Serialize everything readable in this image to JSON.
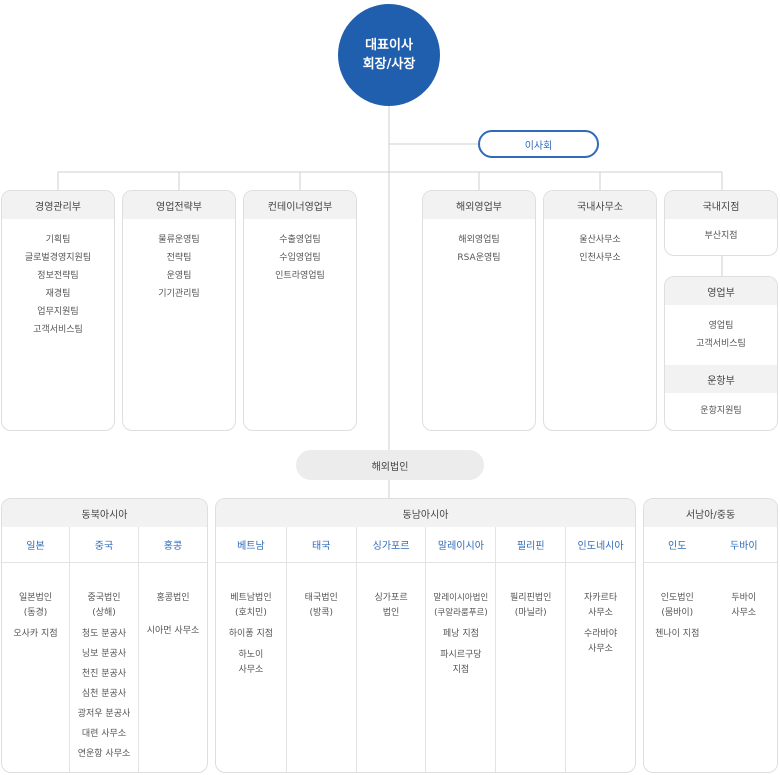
{
  "ceo": {
    "line1": "대표이사",
    "line2": "회장/사장"
  },
  "board": "이사회",
  "overseas": "해외법인",
  "departments": [
    {
      "name": "경영관리부",
      "items": [
        "기획팀",
        "글로벌경영지원팀",
        "정보전략팀",
        "재경팀",
        "업무지원팀",
        "고객서비스팀"
      ]
    },
    {
      "name": "영업전략부",
      "items": [
        "물류운영팀",
        "전략팀",
        "운영팀",
        "기기관리팀"
      ]
    },
    {
      "name": "컨테이너영업부",
      "items": [
        "수출영업팀",
        "수입영업팀",
        "인트라영업팀"
      ]
    },
    {
      "name": "해외영업부",
      "items": [
        "해외영업팀",
        "RSA운영팀"
      ]
    },
    {
      "name": "국내사무소",
      "items": [
        "울산사무소",
        "인천사무소"
      ]
    },
    {
      "name": "국내지점",
      "items": [
        "부산지점"
      ]
    }
  ],
  "sales_dept": {
    "name": "영업부",
    "items": [
      "영업팀",
      "고객서비스팀"
    ]
  },
  "ops_dept": {
    "name": "운항부",
    "items": [
      "운항지원팀"
    ]
  },
  "regions": [
    {
      "name": "동북아시아",
      "countries": [
        {
          "name": "일본",
          "entries": [
            "일본법인\n(동경)",
            "오사카 지점"
          ]
        },
        {
          "name": "중국",
          "entries": [
            "중국법인\n(상해)",
            "청도 분공사",
            "닝보 분공사",
            "천진 분공사",
            "심천 분공사",
            "광저우 분공사",
            "대련 사무소",
            "연운항 사무소"
          ]
        },
        {
          "name": "홍콩",
          "entries": [
            "홍콩법인",
            "시아먼 사무소"
          ]
        }
      ]
    },
    {
      "name": "동남아시아",
      "countries": [
        {
          "name": "베트남",
          "entries": [
            "베트남법인\n(호치민)",
            "하이퐁 지점",
            "하노이\n사무소"
          ]
        },
        {
          "name": "태국",
          "entries": [
            "태국법인\n(방콕)"
          ]
        },
        {
          "name": "싱가포르",
          "entries": [
            "싱가포르\n법인"
          ]
        },
        {
          "name": "말레이시아",
          "entries": [
            "말레이시아법인\n(쿠알라룸푸르)",
            "페낭 지점",
            "파시르구당\n지점"
          ]
        },
        {
          "name": "필리핀",
          "entries": [
            "필리핀법인\n(마닐라)"
          ]
        },
        {
          "name": "인도네시아",
          "entries": [
            "자카르타\n사무소",
            "수라바야\n사무소"
          ]
        }
      ]
    },
    {
      "name": "서남아/중동",
      "countries": [
        {
          "name": "인도",
          "entries": [
            "인도법인\n(뭄바이)",
            "첸나이 지점"
          ]
        },
        {
          "name": "두바이",
          "entries": [
            "두바이\n사무소"
          ]
        }
      ]
    }
  ]
}
